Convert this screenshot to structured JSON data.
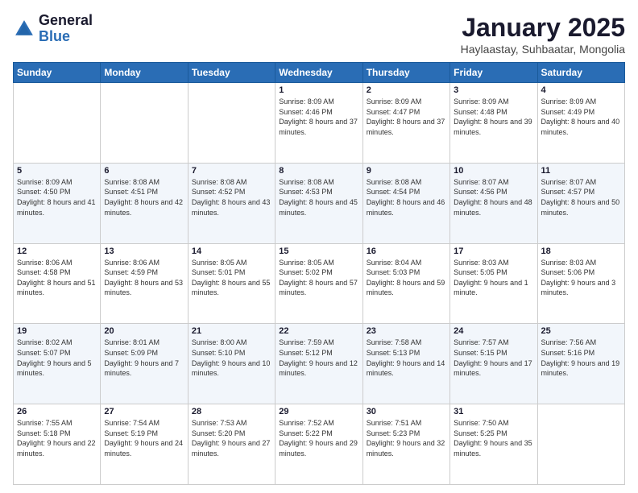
{
  "header": {
    "logo_general": "General",
    "logo_blue": "Blue",
    "title": "January 2025",
    "subtitle": "Haylaastay, Suhbaatar, Mongolia"
  },
  "days_of_week": [
    "Sunday",
    "Monday",
    "Tuesday",
    "Wednesday",
    "Thursday",
    "Friday",
    "Saturday"
  ],
  "weeks": [
    [
      {
        "day": "",
        "sunrise": "",
        "sunset": "",
        "daylight": ""
      },
      {
        "day": "",
        "sunrise": "",
        "sunset": "",
        "daylight": ""
      },
      {
        "day": "",
        "sunrise": "",
        "sunset": "",
        "daylight": ""
      },
      {
        "day": "1",
        "sunrise": "Sunrise: 8:09 AM",
        "sunset": "Sunset: 4:46 PM",
        "daylight": "Daylight: 8 hours and 37 minutes."
      },
      {
        "day": "2",
        "sunrise": "Sunrise: 8:09 AM",
        "sunset": "Sunset: 4:47 PM",
        "daylight": "Daylight: 8 hours and 37 minutes."
      },
      {
        "day": "3",
        "sunrise": "Sunrise: 8:09 AM",
        "sunset": "Sunset: 4:48 PM",
        "daylight": "Daylight: 8 hours and 39 minutes."
      },
      {
        "day": "4",
        "sunrise": "Sunrise: 8:09 AM",
        "sunset": "Sunset: 4:49 PM",
        "daylight": "Daylight: 8 hours and 40 minutes."
      }
    ],
    [
      {
        "day": "5",
        "sunrise": "Sunrise: 8:09 AM",
        "sunset": "Sunset: 4:50 PM",
        "daylight": "Daylight: 8 hours and 41 minutes."
      },
      {
        "day": "6",
        "sunrise": "Sunrise: 8:08 AM",
        "sunset": "Sunset: 4:51 PM",
        "daylight": "Daylight: 8 hours and 42 minutes."
      },
      {
        "day": "7",
        "sunrise": "Sunrise: 8:08 AM",
        "sunset": "Sunset: 4:52 PM",
        "daylight": "Daylight: 8 hours and 43 minutes."
      },
      {
        "day": "8",
        "sunrise": "Sunrise: 8:08 AM",
        "sunset": "Sunset: 4:53 PM",
        "daylight": "Daylight: 8 hours and 45 minutes."
      },
      {
        "day": "9",
        "sunrise": "Sunrise: 8:08 AM",
        "sunset": "Sunset: 4:54 PM",
        "daylight": "Daylight: 8 hours and 46 minutes."
      },
      {
        "day": "10",
        "sunrise": "Sunrise: 8:07 AM",
        "sunset": "Sunset: 4:56 PM",
        "daylight": "Daylight: 8 hours and 48 minutes."
      },
      {
        "day": "11",
        "sunrise": "Sunrise: 8:07 AM",
        "sunset": "Sunset: 4:57 PM",
        "daylight": "Daylight: 8 hours and 50 minutes."
      }
    ],
    [
      {
        "day": "12",
        "sunrise": "Sunrise: 8:06 AM",
        "sunset": "Sunset: 4:58 PM",
        "daylight": "Daylight: 8 hours and 51 minutes."
      },
      {
        "day": "13",
        "sunrise": "Sunrise: 8:06 AM",
        "sunset": "Sunset: 4:59 PM",
        "daylight": "Daylight: 8 hours and 53 minutes."
      },
      {
        "day": "14",
        "sunrise": "Sunrise: 8:05 AM",
        "sunset": "Sunset: 5:01 PM",
        "daylight": "Daylight: 8 hours and 55 minutes."
      },
      {
        "day": "15",
        "sunrise": "Sunrise: 8:05 AM",
        "sunset": "Sunset: 5:02 PM",
        "daylight": "Daylight: 8 hours and 57 minutes."
      },
      {
        "day": "16",
        "sunrise": "Sunrise: 8:04 AM",
        "sunset": "Sunset: 5:03 PM",
        "daylight": "Daylight: 8 hours and 59 minutes."
      },
      {
        "day": "17",
        "sunrise": "Sunrise: 8:03 AM",
        "sunset": "Sunset: 5:05 PM",
        "daylight": "Daylight: 9 hours and 1 minute."
      },
      {
        "day": "18",
        "sunrise": "Sunrise: 8:03 AM",
        "sunset": "Sunset: 5:06 PM",
        "daylight": "Daylight: 9 hours and 3 minutes."
      }
    ],
    [
      {
        "day": "19",
        "sunrise": "Sunrise: 8:02 AM",
        "sunset": "Sunset: 5:07 PM",
        "daylight": "Daylight: 9 hours and 5 minutes."
      },
      {
        "day": "20",
        "sunrise": "Sunrise: 8:01 AM",
        "sunset": "Sunset: 5:09 PM",
        "daylight": "Daylight: 9 hours and 7 minutes."
      },
      {
        "day": "21",
        "sunrise": "Sunrise: 8:00 AM",
        "sunset": "Sunset: 5:10 PM",
        "daylight": "Daylight: 9 hours and 10 minutes."
      },
      {
        "day": "22",
        "sunrise": "Sunrise: 7:59 AM",
        "sunset": "Sunset: 5:12 PM",
        "daylight": "Daylight: 9 hours and 12 minutes."
      },
      {
        "day": "23",
        "sunrise": "Sunrise: 7:58 AM",
        "sunset": "Sunset: 5:13 PM",
        "daylight": "Daylight: 9 hours and 14 minutes."
      },
      {
        "day": "24",
        "sunrise": "Sunrise: 7:57 AM",
        "sunset": "Sunset: 5:15 PM",
        "daylight": "Daylight: 9 hours and 17 minutes."
      },
      {
        "day": "25",
        "sunrise": "Sunrise: 7:56 AM",
        "sunset": "Sunset: 5:16 PM",
        "daylight": "Daylight: 9 hours and 19 minutes."
      }
    ],
    [
      {
        "day": "26",
        "sunrise": "Sunrise: 7:55 AM",
        "sunset": "Sunset: 5:18 PM",
        "daylight": "Daylight: 9 hours and 22 minutes."
      },
      {
        "day": "27",
        "sunrise": "Sunrise: 7:54 AM",
        "sunset": "Sunset: 5:19 PM",
        "daylight": "Daylight: 9 hours and 24 minutes."
      },
      {
        "day": "28",
        "sunrise": "Sunrise: 7:53 AM",
        "sunset": "Sunset: 5:20 PM",
        "daylight": "Daylight: 9 hours and 27 minutes."
      },
      {
        "day": "29",
        "sunrise": "Sunrise: 7:52 AM",
        "sunset": "Sunset: 5:22 PM",
        "daylight": "Daylight: 9 hours and 29 minutes."
      },
      {
        "day": "30",
        "sunrise": "Sunrise: 7:51 AM",
        "sunset": "Sunset: 5:23 PM",
        "daylight": "Daylight: 9 hours and 32 minutes."
      },
      {
        "day": "31",
        "sunrise": "Sunrise: 7:50 AM",
        "sunset": "Sunset: 5:25 PM",
        "daylight": "Daylight: 9 hours and 35 minutes."
      },
      {
        "day": "",
        "sunrise": "",
        "sunset": "",
        "daylight": ""
      }
    ]
  ]
}
